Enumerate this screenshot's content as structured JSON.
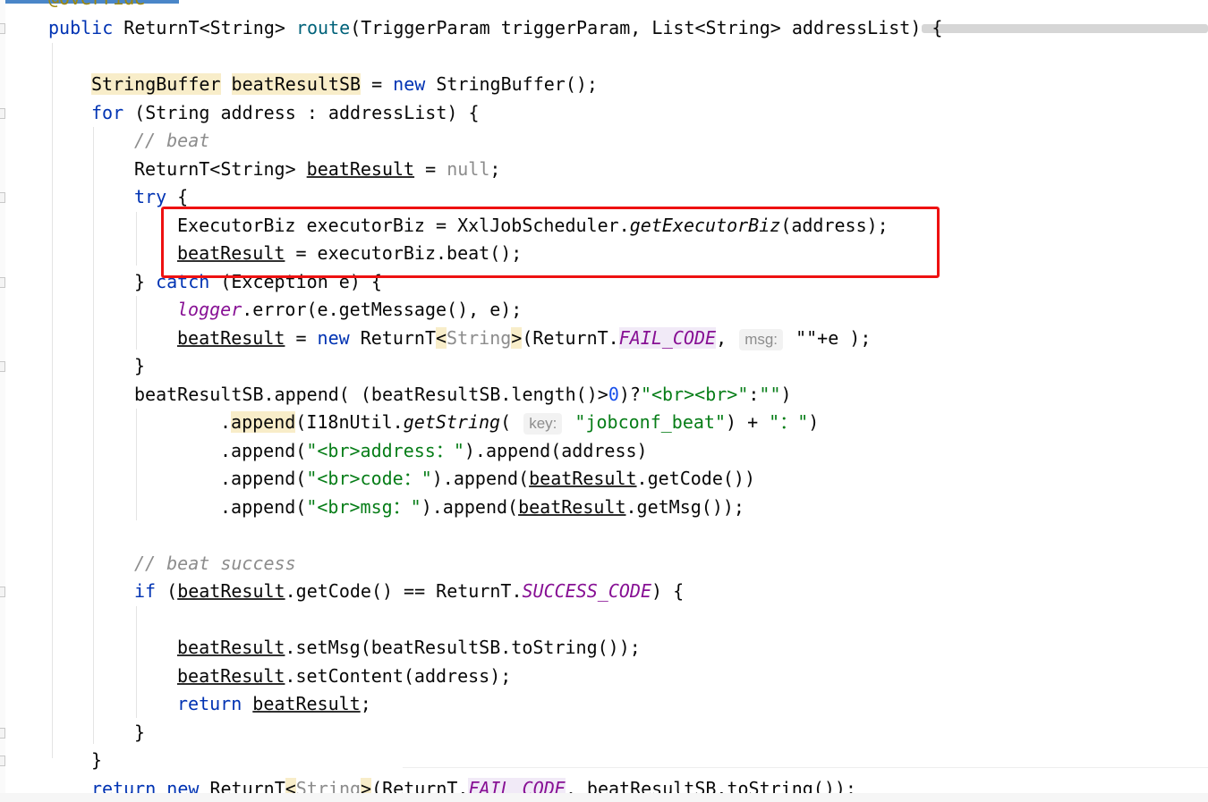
{
  "code": {
    "annotation": "@Override",
    "signature": {
      "kw": "public",
      "type": "ReturnT<String>",
      "method": "route",
      "params": "(TriggerParam triggerParam, List<String> addressList) {"
    },
    "l_sb": {
      "type": "StringBuffer",
      "var": "beatResultSB",
      "eq": " = ",
      "kw": "new",
      "rest": " StringBuffer();"
    },
    "l_for": {
      "kw": "for",
      "rest": " (String address : addressList) {"
    },
    "c_beat": "// beat",
    "l_decl": {
      "type": "ReturnT<String> ",
      "var": "beatResult",
      "eq": " = ",
      "null": "null",
      "end": ";"
    },
    "l_try": {
      "kw": "try",
      "rest": " {"
    },
    "l_exec": {
      "a": "ExecutorBiz executorBiz = XxlJobScheduler.",
      "method": "getExecutorBiz",
      "b": "(address);"
    },
    "l_beat": {
      "var": "beatResult",
      "rest": " = executorBiz.beat();"
    },
    "l_catch": {
      "a": "} ",
      "kw": "catch",
      "b": " (Exception e) {"
    },
    "l_logger": {
      "field": "logger",
      "rest": ".error(e.getMessage(), e);"
    },
    "l_fail": {
      "var": "beatResult",
      "eq": " = ",
      "kw": "new",
      "a": " ReturnT",
      "lt": "<",
      "gen": "String",
      "gt": ">",
      "b": "(ReturnT.",
      "field": "FAIL_CODE",
      "c": ", ",
      "hint": "msg:",
      "d": " \"\"+e );"
    },
    "l_close1": "}",
    "l_append1": {
      "a": "beatResultSB.append( (beatResultSB.length()>",
      "num": "0",
      "b": ")?",
      "s1": "\"<br><br>\"",
      "c": ":",
      "s2": "\"\"",
      "d": ")"
    },
    "l_append2": {
      "dot": ".",
      "m": "append",
      "a": "(I18nUtil.",
      "method": "getString",
      "b": "( ",
      "hint": "key:",
      "s": " \"jobconf_beat\"",
      "c": ") + ",
      "s2": "\"：\"",
      "d": ")"
    },
    "l_append3": {
      "a": ".append(",
      "s": "\"<br>address：\"",
      "b": ").append(address)"
    },
    "l_append4": {
      "a": ".append(",
      "s": "\"<br>code：\"",
      "b": ").append(",
      "var": "beatResult",
      "c": ".getCode())"
    },
    "l_append5": {
      "a": ".append(",
      "s": "\"<br>msg：\"",
      "b": ").append(",
      "var": "beatResult",
      "c": ".getMsg());"
    },
    "c_success": "// beat success",
    "l_if": {
      "kw": "if",
      "a": " (",
      "var": "beatResult",
      "b": ".getCode() == ReturnT.",
      "field": "SUCCESS_CODE",
      "c": ") {"
    },
    "l_setmsg": {
      "var": "beatResult",
      "rest": ".setMsg(beatResultSB.toString());"
    },
    "l_setcontent": {
      "var": "beatResult",
      "rest": ".setContent(address);"
    },
    "l_return": {
      "kw": "return",
      "sp": " ",
      "var": "beatResult",
      "end": ";"
    },
    "l_close2": "}",
    "l_close3": "}",
    "l_final": {
      "kw1": "return",
      "sp": " ",
      "kw2": "new",
      "a": " ReturnT",
      "lt": "<",
      "gen": "String",
      "gt": ">",
      "b": "(ReturnT.",
      "field": "FAIL_CODE",
      "c": ", beatResultSB.toString());"
    }
  },
  "highlight_box_color": "#ee1111"
}
